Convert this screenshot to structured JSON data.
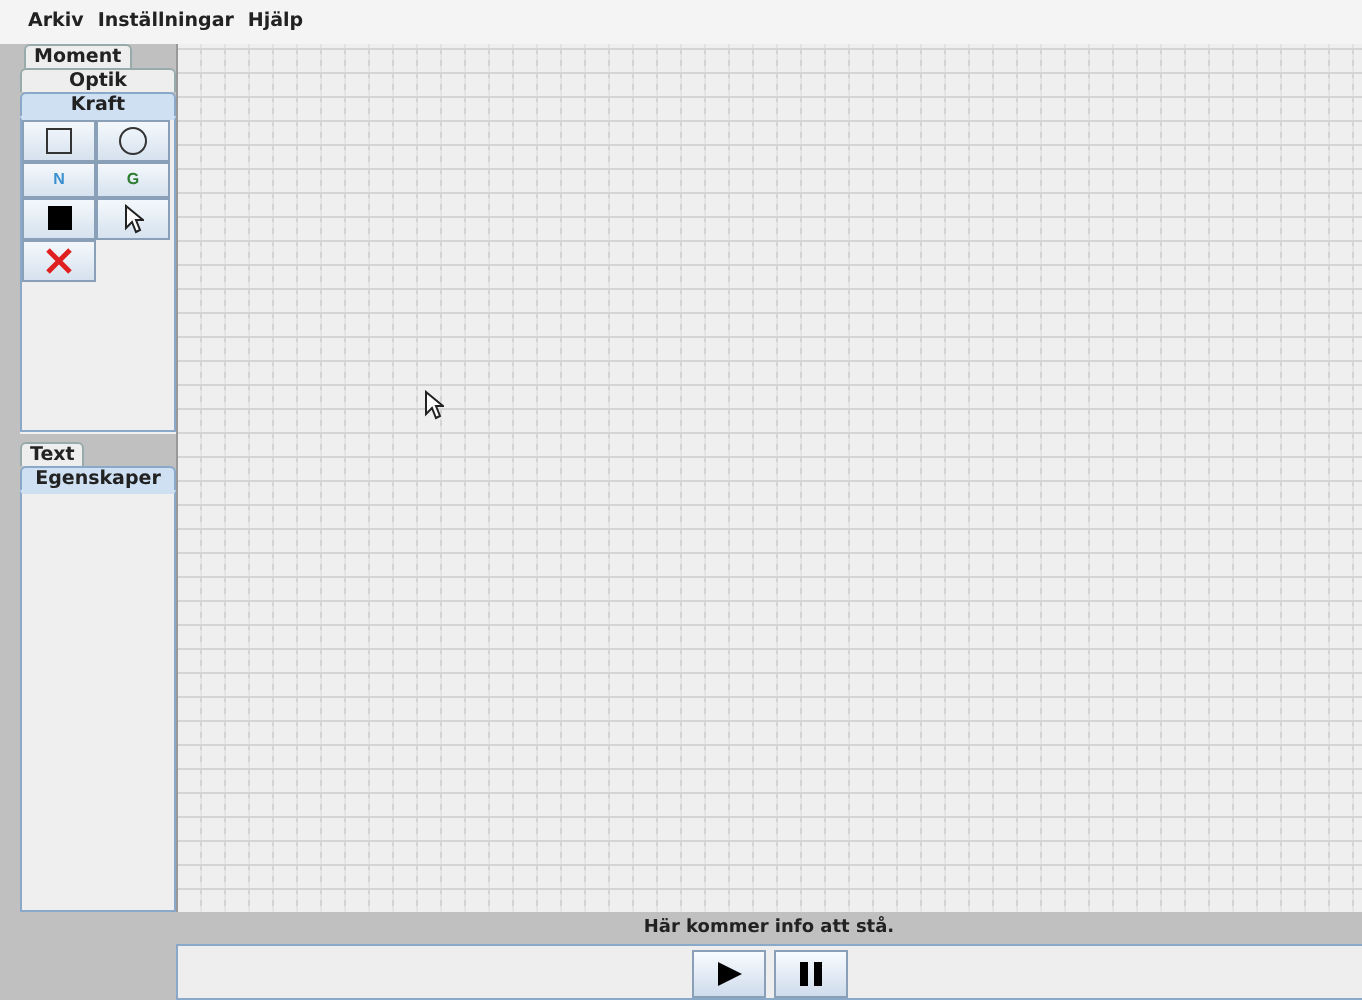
{
  "menu": [
    "Arkiv",
    "Inställningar",
    "Hjälp"
  ],
  "upper_tabs": [
    {
      "label": "Moment",
      "selected": false
    },
    {
      "label": "Optik",
      "selected": false
    },
    {
      "label": "Kraft",
      "selected": true
    }
  ],
  "tools": [
    {
      "kind": "square"
    },
    {
      "kind": "circle"
    },
    {
      "kind": "text",
      "label": "N",
      "color": "#3a8fd0"
    },
    {
      "kind": "text",
      "label": "G",
      "color": "#2e7d32"
    },
    {
      "kind": "filled-square"
    },
    {
      "kind": "pointer"
    },
    {
      "kind": "delete"
    }
  ],
  "lower_tabs": [
    {
      "label": "Text",
      "selected": false
    },
    {
      "label": "Egenskaper",
      "selected": true
    }
  ],
  "status": "Här kommer info att stå.",
  "controls": [
    {
      "kind": "play"
    },
    {
      "kind": "pause"
    }
  ]
}
